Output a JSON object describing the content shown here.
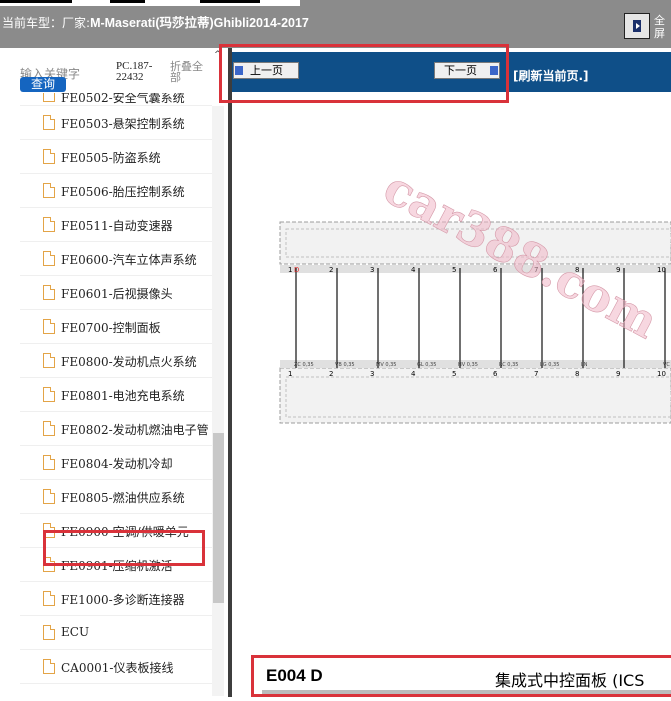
{
  "header": {
    "car_prefix": "当前车型：",
    "car_brand": "厂家:",
    "car_model": "M-Maserati(玛莎拉蒂)Ghibli2014-2017",
    "fullscreen_text": "全屏"
  },
  "sidebar": {
    "search_placeholder": "输入关键字",
    "search_button": "查询",
    "pc_code": "PC.187-22432",
    "collapse_all": "折叠全部",
    "items": [
      {
        "label": "FE0502-安全气囊系统"
      },
      {
        "label": "FE0503-悬架控制系统"
      },
      {
        "label": "FE0505-防盗系统"
      },
      {
        "label": "FE0506-胎压控制系统"
      },
      {
        "label": "FE0511-自动变速器"
      },
      {
        "label": "FE0600-汽车立体声系统"
      },
      {
        "label": "FE0601-后视摄像头"
      },
      {
        "label": "FE0700-控制面板"
      },
      {
        "label": "FE0800-发动机点火系统"
      },
      {
        "label": "FE0801-电池充电系统"
      },
      {
        "label": "FE0802-发动机燃油电子管"
      },
      {
        "label": "FE0804-发动机冷却"
      },
      {
        "label": "FE0805-燃油供应系统"
      },
      {
        "label": "FE0900-空调/供暖单元"
      },
      {
        "label": "FE0901-压缩机激活"
      },
      {
        "label": "FE1000-多诊断连接器"
      },
      {
        "label": "ECU"
      },
      {
        "label": "CA0001-仪表板接线"
      }
    ]
  },
  "toolbar": {
    "prev_label": "上一页",
    "next_label": "下一页",
    "refresh_label": "[刷新当前页.]"
  },
  "diagram": {
    "top_pins": [
      "1",
      "2",
      "3",
      "4",
      "5",
      "6",
      "7",
      "8",
      "9",
      "10"
    ],
    "top_pin_marker": "D",
    "wire_labels": [
      "ZC 0,35",
      "VB 0,35",
      "MV 0,35",
      "GL 0,35",
      "HV 0,35",
      "RC 0,35",
      "LG 0,35",
      "LN",
      "",
      "VC 0"
    ],
    "bottom_pins": [
      "1",
      "2",
      "3",
      "4",
      "5",
      "6",
      "7",
      "8",
      "9",
      "10"
    ],
    "watermark": "car388.com"
  },
  "footer": {
    "connector_code": "E004 D",
    "connector_name": "集成式中控面板 (ICS"
  },
  "colors": {
    "navbar": "#0f4f88",
    "highlight": "#d9323a",
    "search_button": "#1565c0",
    "header": "#8b8b8b"
  }
}
